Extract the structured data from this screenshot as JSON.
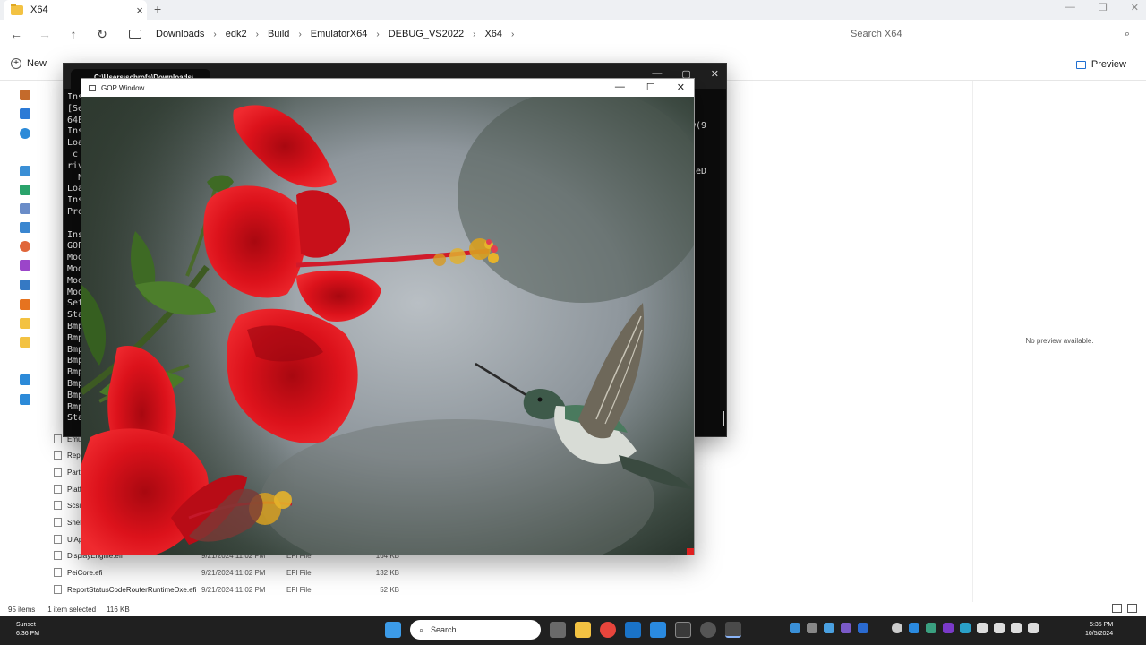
{
  "explorer": {
    "tab_title": "X64",
    "new_tab_glyph": "+",
    "nav": {
      "back_glyph": "←",
      "forward_glyph": "→",
      "up_glyph": "↑",
      "refresh_glyph": "↻"
    },
    "breadcrumbs": [
      "Downloads",
      "edk2",
      "Build",
      "EmulatorX64",
      "DEBUG_VS2022",
      "X64"
    ],
    "breadcrumb_sep": "›",
    "search_placeholder": "Search X64",
    "new_label": "New",
    "preview_label": "Preview",
    "files": [
      {
        "name": "Emu",
        "date": "",
        "type": "",
        "size": ""
      },
      {
        "name": "Repo",
        "date": "",
        "type": "",
        "size": ""
      },
      {
        "name": "Parti",
        "date": "",
        "type": "",
        "size": ""
      },
      {
        "name": "Platf",
        "date": "",
        "type": "",
        "size": ""
      },
      {
        "name": "ScsiI",
        "date": "",
        "type": "",
        "size": ""
      },
      {
        "name": "Shell",
        "date": "",
        "type": "",
        "size": ""
      },
      {
        "name": "UiAp",
        "date": "",
        "type": "",
        "size": ""
      },
      {
        "name": "DisplayEngine.efi",
        "date": "9/21/2024 11:02 PM",
        "type": "EFI File",
        "size": "164 KB"
      },
      {
        "name": "PeiCore.efi",
        "date": "9/21/2024 11:02 PM",
        "type": "EFI File",
        "size": "132 KB"
      },
      {
        "name": "ReportStatusCodeRouterRuntimeDxe.efi",
        "date": "9/21/2024 11:02 PM",
        "type": "EFI File",
        "size": "52 KB"
      }
    ],
    "no_preview": "No preview available.",
    "status": {
      "items": "95 items",
      "selected": "1 item selected",
      "size": "116 KB"
    }
  },
  "terminal": {
    "tab_title": "C:\\Users\\schrofa\\Downloads\\",
    "lines": [
      "Ins",
      "[Se",
      "64E",
      "Ins",
      "Loa",
      " c",
      "riv",
      "  N",
      "Loa",
      "Ins",
      "Pro",
      "  ",
      "Ins",
      "GOP",
      "Mod",
      "Mod",
      "Mod",
      "Mod",
      "Set",
      "Sta",
      "Bmp",
      "Bmp",
      "Bmp",
      "Bmp",
      "Bmp",
      "Bmp",
      "Bmp",
      "Bmp",
      "Sta"
    ],
    "right_fragments": [
      "w(9",
      "leD"
    ]
  },
  "gop": {
    "title": "GOP Window"
  },
  "taskbar": {
    "weather_name": "Sunset",
    "weather_time": "6:36 PM",
    "search_label": "Search",
    "time": "5:35 PM",
    "date": "10/5/2024"
  },
  "colors": {
    "accent": "#1f6fd1",
    "taskbar": "#202020",
    "hibiscus": "#d8141c",
    "folder": "#f3c242"
  }
}
